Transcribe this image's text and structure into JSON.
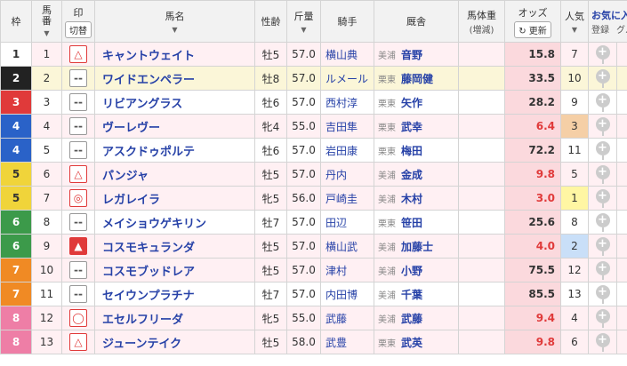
{
  "header": {
    "waku": "枠",
    "umaban": "馬\n番",
    "mark": "印",
    "mark_btn": "切替",
    "name": "馬名",
    "sexage": "性齢",
    "weight": "斤量",
    "jockey": "騎手",
    "stable": "厩舎",
    "body_weight": "馬体重",
    "body_weight_sub": "(増減)",
    "odds": "オッズ",
    "odds_btn": "更新",
    "popularity": "人気",
    "fav": "お気に入り",
    "register": "登録",
    "group": "グル"
  },
  "horses": [
    {
      "waku": "1",
      "num": "1",
      "mark": "triangle",
      "name": "キャントウェイト",
      "sexage": "牡5",
      "weight": "57.0",
      "jockey": "横山典",
      "region": "美浦",
      "trainer": "音野",
      "odds": "15.8",
      "pop": "7"
    },
    {
      "waku": "2",
      "num": "2",
      "mark": "dash",
      "name": "ワイドエンペラー",
      "sexage": "牡8",
      "weight": "57.0",
      "jockey": "ルメール",
      "region": "栗東",
      "trainer": "藤岡健",
      "odds": "33.5",
      "pop": "10"
    },
    {
      "waku": "3",
      "num": "3",
      "mark": "dash",
      "name": "リビアングラス",
      "sexage": "牡6",
      "weight": "57.0",
      "jockey": "西村淳",
      "region": "栗東",
      "trainer": "矢作",
      "odds": "28.2",
      "pop": "9"
    },
    {
      "waku": "4",
      "num": "4",
      "mark": "dash",
      "name": "ヴーレヴー",
      "sexage": "牝4",
      "weight": "55.0",
      "jockey": "吉田隼",
      "region": "栗東",
      "trainer": "武幸",
      "odds": "6.4",
      "pop": "3"
    },
    {
      "waku": "4",
      "num": "5",
      "mark": "dash",
      "name": "アスクドゥポルテ",
      "sexage": "牡6",
      "weight": "57.0",
      "jockey": "岩田康",
      "region": "栗東",
      "trainer": "梅田",
      "odds": "72.2",
      "pop": "11"
    },
    {
      "waku": "5",
      "num": "6",
      "mark": "triangle",
      "name": "パンジャ",
      "sexage": "牡5",
      "weight": "57.0",
      "jockey": "丹内",
      "region": "美浦",
      "trainer": "金成",
      "odds": "9.8",
      "pop": "5"
    },
    {
      "waku": "5",
      "num": "7",
      "mark": "double",
      "name": "レガレイラ",
      "sexage": "牝5",
      "weight": "56.0",
      "jockey": "戸崎圭",
      "region": "美浦",
      "trainer": "木村",
      "odds": "3.0",
      "pop": "1"
    },
    {
      "waku": "6",
      "num": "8",
      "mark": "dash",
      "name": "メイショウゲキリン",
      "sexage": "牡7",
      "weight": "57.0",
      "jockey": "田辺",
      "region": "栗東",
      "trainer": "笹田",
      "odds": "25.6",
      "pop": "8"
    },
    {
      "waku": "6",
      "num": "9",
      "mark": "solid-triangle",
      "name": "コスモキュランダ",
      "sexage": "牡5",
      "weight": "57.0",
      "jockey": "横山武",
      "region": "美浦",
      "trainer": "加藤士",
      "odds": "4.0",
      "pop": "2"
    },
    {
      "waku": "7",
      "num": "10",
      "mark": "dash",
      "name": "コスモブッドレア",
      "sexage": "牡5",
      "weight": "57.0",
      "jockey": "津村",
      "region": "美浦",
      "trainer": "小野",
      "odds": "75.5",
      "pop": "12"
    },
    {
      "waku": "7",
      "num": "11",
      "mark": "dash",
      "name": "セイウンプラチナ",
      "sexage": "牡7",
      "weight": "57.0",
      "jockey": "内田博",
      "region": "美浦",
      "trainer": "千葉",
      "odds": "85.5",
      "pop": "13"
    },
    {
      "waku": "8",
      "num": "12",
      "mark": "circle",
      "name": "エセルフリーダ",
      "sexage": "牝5",
      "weight": "55.0",
      "jockey": "武藤",
      "region": "美浦",
      "trainer": "武藤",
      "odds": "9.4",
      "pop": "4"
    },
    {
      "waku": "8",
      "num": "13",
      "mark": "triangle",
      "name": "ジューンテイク",
      "sexage": "牡5",
      "weight": "58.0",
      "jockey": "武豊",
      "region": "栗東",
      "trainer": "武英",
      "odds": "9.8",
      "pop": "6"
    }
  ],
  "colors": {
    "accent": "#2641a7",
    "red": "#e03a3a",
    "odds_bg": "#fbd9dd"
  }
}
